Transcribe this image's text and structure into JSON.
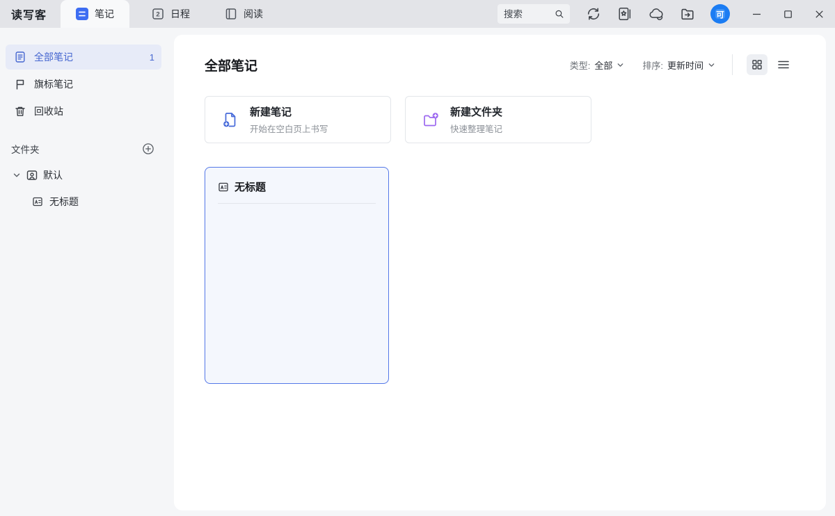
{
  "app": {
    "title": "读写客",
    "avatar_text": "可"
  },
  "colors": {
    "accent_blue": "#4569d9",
    "tab_icon_blue": "#3d6df2",
    "folder_purple": "#9c68f0",
    "avatar_blue": "#1b7cf3",
    "note_card_border": "#5377e8",
    "sidebar_selected_bg": "#e7ebf8"
  },
  "titlebar": {
    "tabs": [
      {
        "label": "笔记",
        "icon": "notes-icon",
        "active": true
      },
      {
        "label": "日程",
        "icon": "calendar-icon",
        "badge": "2",
        "active": false
      },
      {
        "label": "阅读",
        "icon": "book-icon",
        "active": false
      }
    ],
    "search": {
      "placeholder": "搜索",
      "icon": "search-icon"
    },
    "toolbar_icons": [
      "sync-icon",
      "notebook-star-icon",
      "cloud-icon",
      "folder-export-icon"
    ],
    "window_controls": [
      "minimize",
      "maximize",
      "close"
    ]
  },
  "sidebar": {
    "items": [
      {
        "label": "全部笔记",
        "icon": "document-icon",
        "count": "1",
        "selected": true
      },
      {
        "label": "旗标笔记",
        "icon": "flag-icon",
        "selected": false
      },
      {
        "label": "回收站",
        "icon": "trash-icon",
        "selected": false
      }
    ],
    "folders_section": {
      "label": "文件夹",
      "add_icon": "plus-circle-icon",
      "folders": [
        {
          "label": "默认",
          "icon": "folder-user-icon",
          "expanded": true,
          "children": [
            {
              "label": "无标题",
              "icon": "note-icon"
            }
          ]
        }
      ]
    }
  },
  "main": {
    "title": "全部笔记",
    "filters": {
      "type_label": "类型:",
      "type_value": "全部",
      "sort_label": "排序:",
      "sort_value": "更新时间"
    },
    "view_toggle": {
      "active": "grid"
    },
    "actions": [
      {
        "title": "新建笔记",
        "subtitle": "开始在空白页上书写",
        "icon": "new-note-icon"
      },
      {
        "title": "新建文件夹",
        "subtitle": "快速整理笔记",
        "icon": "new-folder-icon"
      }
    ],
    "notes": [
      {
        "title": "无标题",
        "icon": "note-icon",
        "selected": true
      }
    ]
  }
}
